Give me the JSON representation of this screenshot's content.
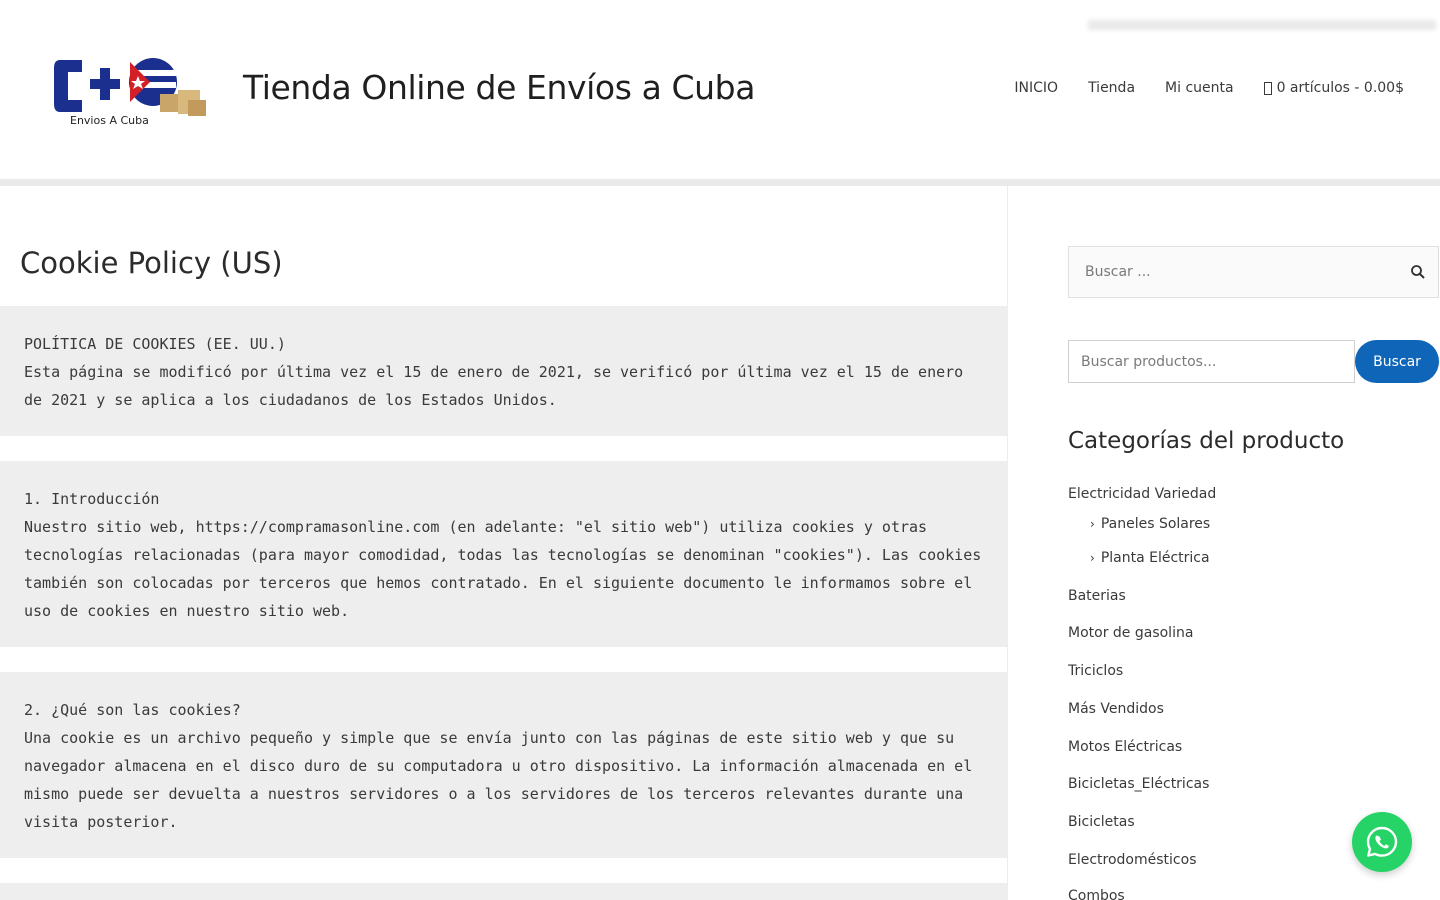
{
  "header": {
    "site_title": "Tienda Online de Envíos a Cuba",
    "logo_text": "Envios A Cuba",
    "nav": [
      "INICIO",
      "Tienda",
      "Mi cuenta"
    ],
    "cart_label": "0 artículos - 0.00$"
  },
  "main": {
    "page_title": "Cookie Policy (US)",
    "blocks": [
      {
        "title": "POLÍTICA DE COOKIES (EE. UU.)",
        "text": "Esta página se modificó por última vez el 15 de enero de 2021, se verificó por última vez el 15 de enero de 2021 y se aplica a los ciudadanos de los Estados Unidos."
      },
      {
        "title": "1. Introducción",
        "text": "Nuestro sitio web, https://compramasonline.com (en adelante: \"el sitio web\") utiliza cookies y otras tecnologías relacionadas (para mayor comodidad, todas las tecnologías se denominan \"cookies\"). Las cookies también son colocadas por terceros que hemos contratado. En el siguiente documento le informamos sobre el uso de cookies en nuestro sitio web."
      },
      {
        "title": "2. ¿Qué son las cookies?",
        "text": "Una cookie es un archivo pequeño y simple que se envía junto con las páginas de este sitio web y que su navegador almacena en el disco duro de su computadora u otro dispositivo. La información almacenada en el mismo puede ser devuelta a nuestros servidores o a los servidores de los terceros relevantes durante una visita posterior."
      }
    ]
  },
  "sidebar": {
    "search_placeholder": "Buscar ...",
    "product_search_placeholder": "Buscar productos...",
    "product_search_button": "Buscar",
    "categories_title": "Categorías del producto",
    "categories": [
      {
        "label": "Electricidad Variedad"
      },
      {
        "label": "Paneles Solares",
        "sub": true
      },
      {
        "label": "Planta Eléctrica",
        "sub": true
      },
      {
        "label": "Baterias"
      },
      {
        "label": "Motor de gasolina"
      },
      {
        "label": "Triciclos"
      },
      {
        "label": "Más Vendidos"
      },
      {
        "label": "Motos Eléctricas"
      },
      {
        "label": "Bicicletas_Eléctricas"
      },
      {
        "label": "Bicicletas"
      },
      {
        "label": "Electrodomésticos"
      },
      {
        "label": "Combos"
      }
    ]
  },
  "colors": {
    "accent": "#0f66b8",
    "whatsapp": "#25d366",
    "block_bg": "#eeeeee"
  },
  "icons": [
    "search-icon",
    "cart-icon",
    "chevron-right-icon",
    "whatsapp-icon",
    "site-logo"
  ]
}
